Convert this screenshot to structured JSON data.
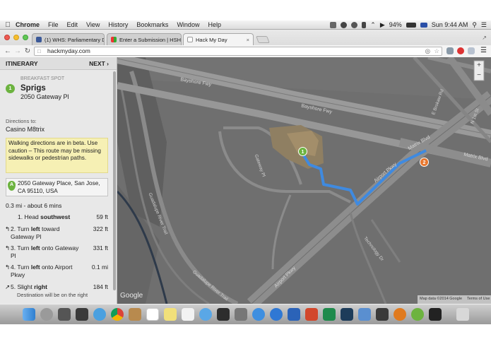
{
  "menubar": {
    "app": "Chrome",
    "items": [
      "File",
      "Edit",
      "View",
      "History",
      "Bookmarks",
      "Window",
      "Help"
    ],
    "battery": "94%",
    "clock": "Sun 9:44 AM"
  },
  "tabs": [
    {
      "title": "(1) WHS: Parliamentary De"
    },
    {
      "title": "Enter a Submission | HSHa"
    },
    {
      "title": "Hack My Day"
    }
  ],
  "address": "hackmyday.com",
  "sidebar": {
    "header": "ITINERARY",
    "next": "NEXT ›",
    "spot_badge": "1",
    "spot_type": "BREAKFAST SPOT",
    "spot_name": "Sprigs",
    "spot_address": "2050 Gateway Pl",
    "directions_label": "Directions to:",
    "destination": "Casino M8trix",
    "warning": "Walking directions are in beta. Use caution – This route may be missing sidewalks or pedestrian paths.",
    "marker_letter": "A",
    "start_address": "2050 Gateway Place, San Jose, CA 95110, USA",
    "summary": "0.3 mi - about 6 mins",
    "steps": [
      {
        "num": "1.",
        "pre": "Head ",
        "bold": "southwest",
        "post": "",
        "dist": "59 ft",
        "note": ""
      },
      {
        "num": "2.",
        "pre": "Turn ",
        "bold": "left",
        "post": " toward Gateway Pl",
        "dist": "322 ft",
        "note": ""
      },
      {
        "num": "3.",
        "pre": "Turn ",
        "bold": "left",
        "post": " onto Gateway Pl",
        "dist": "331 ft",
        "note": ""
      },
      {
        "num": "4.",
        "pre": "Turn ",
        "bold": "left",
        "post": " onto Airport Pkwy",
        "dist": "0.1 mi",
        "note": ""
      },
      {
        "num": "5.",
        "pre": "Slight ",
        "bold": "right",
        "post": "",
        "dist": "184 ft",
        "note": "Destination will be on the right"
      }
    ]
  },
  "map": {
    "roads": {
      "bayshore_top": "Bayshore Fwy",
      "bayshore_mid": "Bayshore Fwy",
      "matrix_a": "Matrix Blvd",
      "matrix_b": "Matrix Blvd",
      "gateway": "Gateway Pl",
      "airport_a": "Airport Pkwy",
      "airport_b": "Airport Pkwy",
      "guadalupe_a": "Guadalupe River Trail",
      "guadalupe_b": "Guadalupe River Trail",
      "technology": "Technology Dr",
      "ebrokaw": "E Brokaw Rd",
      "n1st": "N 1st St"
    },
    "marker_start": "1",
    "marker_end": "2",
    "zoom_in": "+",
    "zoom_out": "−",
    "google": "Google",
    "attribution": "Map data ©2014 Google",
    "terms": "Terms of Use"
  },
  "colors": {
    "green": "#6cb33f",
    "orange": "#e8772e",
    "route": "#3f8ae0",
    "warning_bg": "#f6f0b4"
  }
}
